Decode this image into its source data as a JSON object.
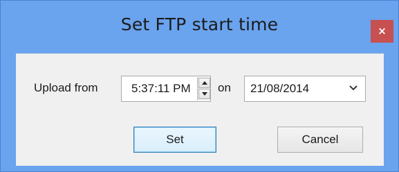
{
  "window": {
    "title": "Set FTP start time",
    "close_glyph": "×",
    "close_icon": "close-icon"
  },
  "form": {
    "upload_label": "Upload from",
    "time_value": "5:37:11 PM",
    "on_label": "on",
    "date_value": "21/08/2014",
    "spinner_up_icon": "arrow-up-icon",
    "spinner_down_icon": "arrow-down-icon",
    "dropdown_icon": "chevron-down-icon"
  },
  "buttons": {
    "set_label": "Set",
    "cancel_label": "Cancel"
  },
  "colors": {
    "frame": "#6aa3ee",
    "close_button": "#c75050",
    "client_area": "#f0f0f0",
    "default_button_border": "#3c7fb1"
  }
}
